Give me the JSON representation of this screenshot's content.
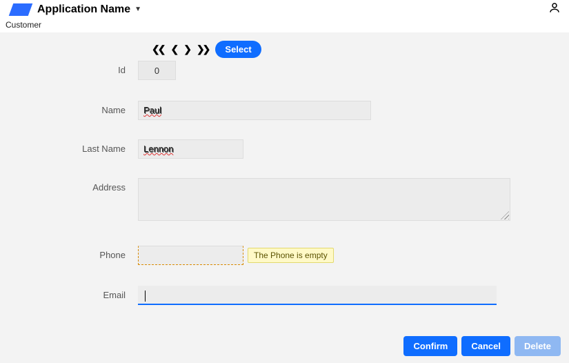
{
  "header": {
    "appName": "Application Name"
  },
  "breadcrumb": "Customer",
  "toolbar": {
    "select_label": "Select"
  },
  "form": {
    "labels": {
      "id": "Id",
      "name": "Name",
      "lastName": "Last Name",
      "address": "Address",
      "phone": "Phone",
      "email": "Email"
    },
    "values": {
      "id": "0",
      "name": "Paul",
      "lastName": "Lennon",
      "address": "",
      "phone": "",
      "email": ""
    },
    "tooltips": {
      "phone_empty": "The Phone is empty"
    }
  },
  "buttons": {
    "confirm": "Confirm",
    "cancel": "Cancel",
    "delete": "Delete"
  }
}
